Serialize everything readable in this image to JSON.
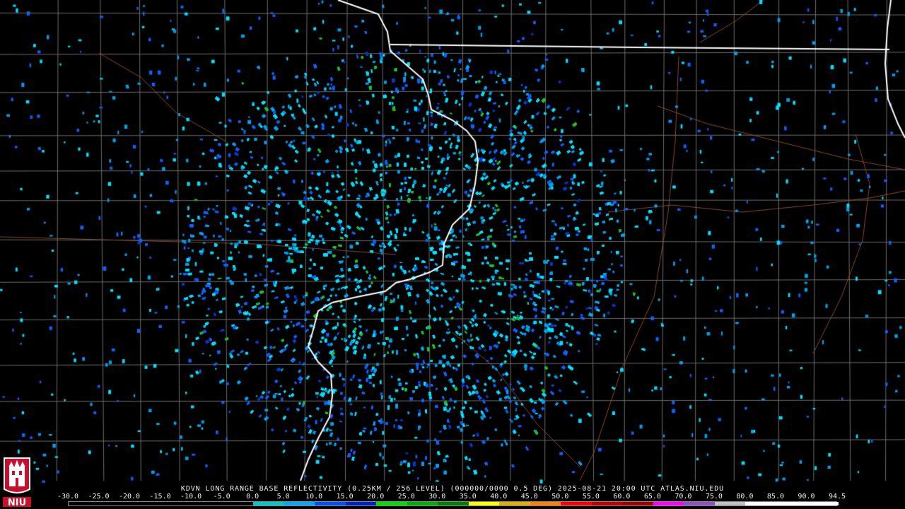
{
  "title_line": "KDVN LONG RANGE BASE REFLECTIVITY (0.25KM / 256 LEVEL) (000000/0000 0.5 DEG) 2025-08-21 20:00 UTC  ATLAS.NIU.EDU",
  "logo": {
    "text": "NIU",
    "color": "#c8102e"
  },
  "legend": {
    "labels": [
      "-30.0",
      "-25.0",
      "-20.0",
      "-15.0",
      "-10.0",
      "-5.0",
      "0.0",
      "5.0",
      "10.0",
      "15.0",
      "20.0",
      "25.0",
      "30.0",
      "35.0",
      "40.0",
      "45.0",
      "50.0",
      "55.0",
      "60.0",
      "65.0",
      "70.0",
      "75.0",
      "80.0",
      "85.0",
      "90.0",
      "94.5"
    ],
    "colors": [
      "#000000",
      "#000000",
      "#000000",
      "#000000",
      "#000000",
      "#000000",
      "#00c8c8",
      "#00a8ff",
      "#0050ff",
      "#0020c8",
      "#00e000",
      "#00b000",
      "#008000",
      "#ffff00",
      "#e0b000",
      "#ff8000",
      "#ff0000",
      "#c00000",
      "#a00000",
      "#ff00ff",
      "#9050c8",
      "#c0c0c0",
      "#ffffff",
      "#ffffff",
      "#ffffff"
    ]
  },
  "radar": {
    "center_color": "#000000",
    "echo_colors": [
      "#00e0ff",
      "#00a0f0",
      "#1060ff",
      "#0838d0",
      "#20c030"
    ]
  },
  "map_colors": {
    "state_border": "#ffffff",
    "county_line": "#6e6e6e",
    "highway": "#8a4a2a"
  }
}
